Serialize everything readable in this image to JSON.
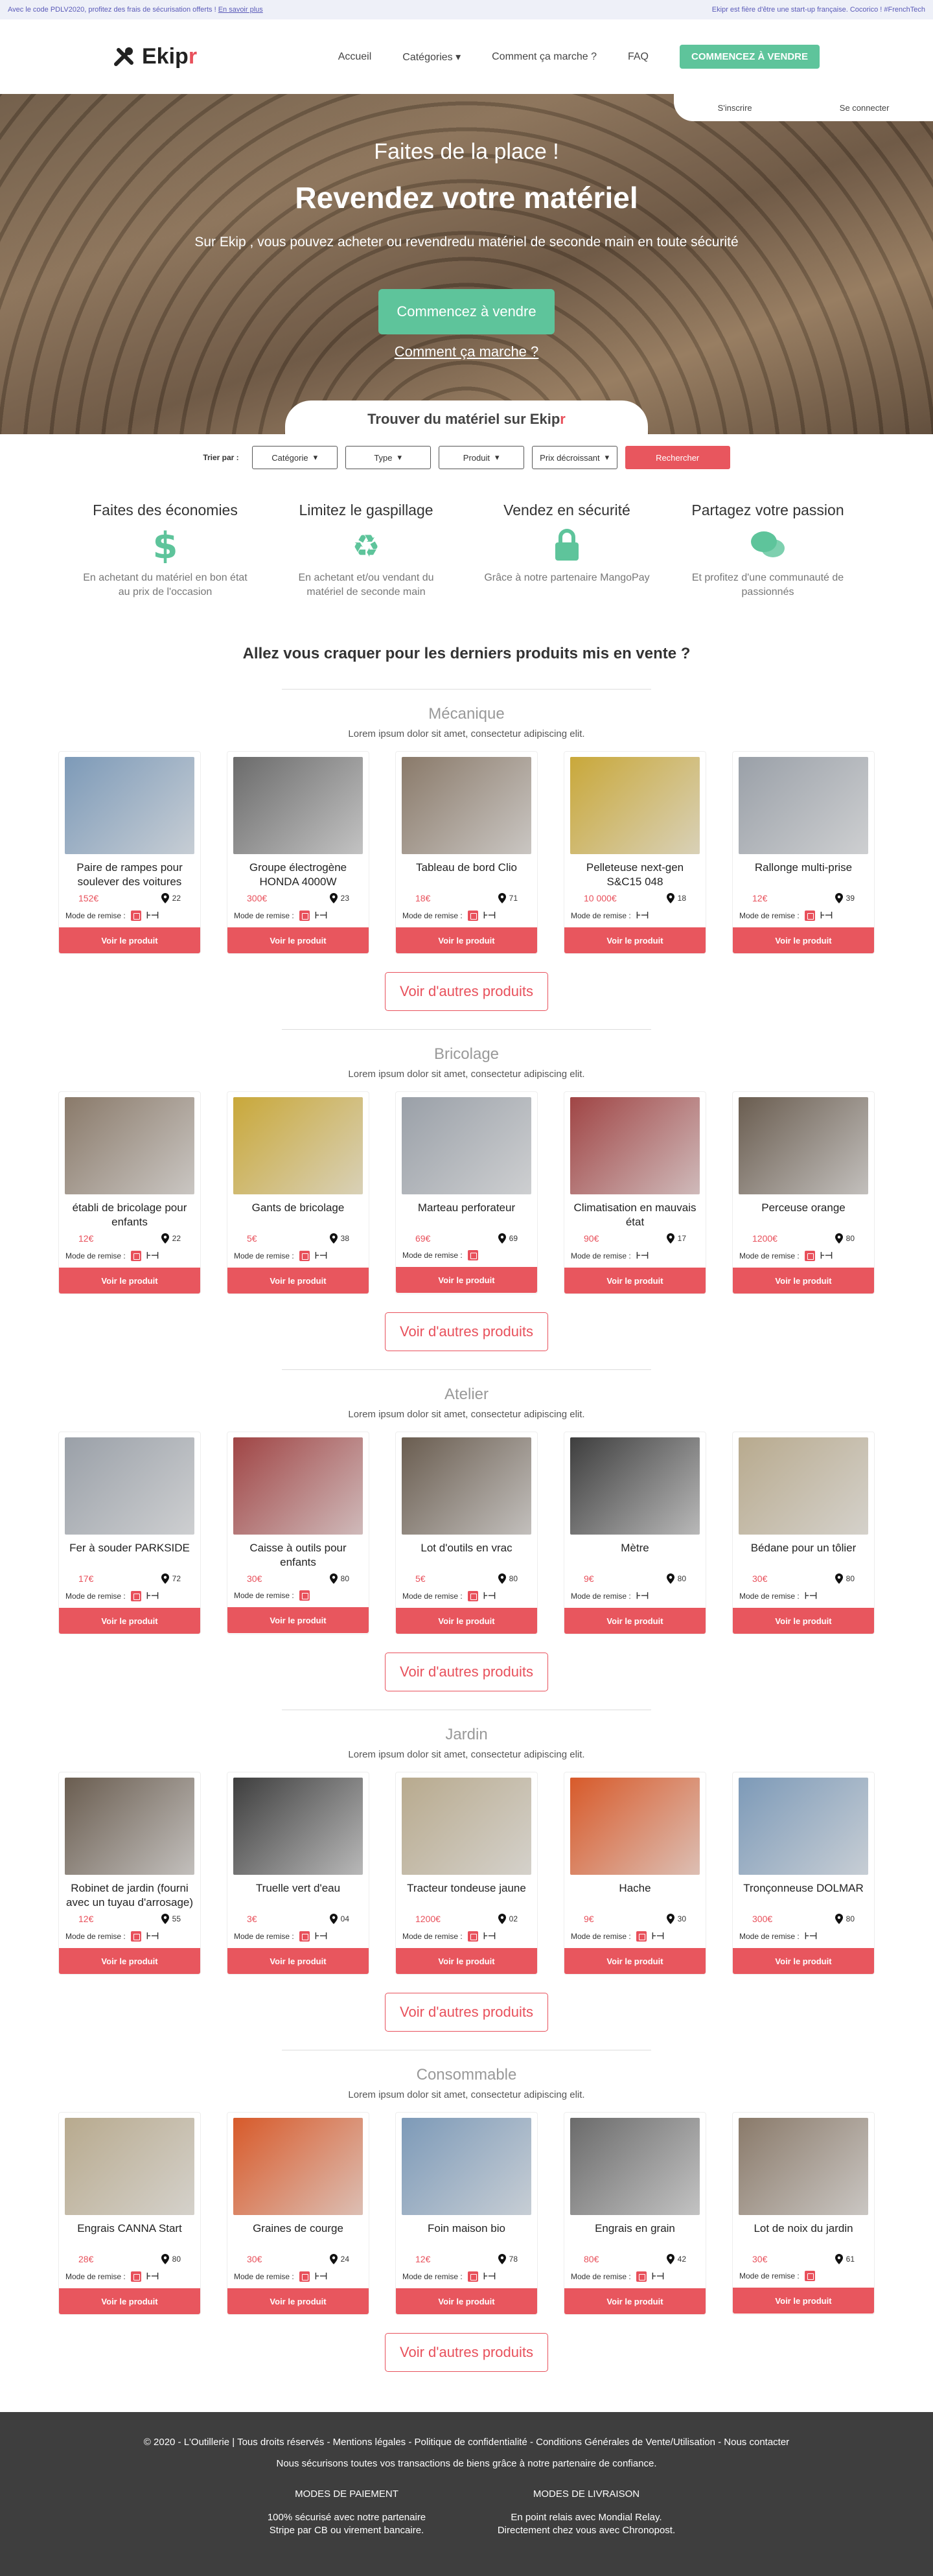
{
  "topbar": {
    "promo": "Avec le code PDLV2020, profitez des frais de sécurisation offerts !",
    "promo_link": "En savoir plus",
    "right": "Ekipr est fière d'être une start-up française. Cocorico ! #FrenchTech"
  },
  "header": {
    "logo_main": "Ekip",
    "logo_accent": "r",
    "nav": [
      "Accueil",
      "Catégories",
      "Comment ça marche ?",
      "FAQ"
    ],
    "cta": "COMMENCEZ À VENDRE"
  },
  "auth": {
    "signup": "S'inscrire",
    "login": "Se connecter"
  },
  "hero": {
    "subtitle": "Faites de la place !",
    "title": "Revendez votre matériel",
    "text": "Sur Ekip , vous pouvez acheter ou revendredu matériel de seconde main en toute sécurité",
    "button": "Commencez à vendre",
    "link": "Comment ça marche ?"
  },
  "search": {
    "title_main": "Trouver du matériel sur Ekip",
    "title_accent": "r",
    "sort_label": "Trier par :",
    "selects": [
      "Catégorie",
      "Type",
      "Produit",
      "Prix décroissant"
    ],
    "button": "Rechercher"
  },
  "features": [
    {
      "title": "Faites des économies",
      "icon": "dollar-icon",
      "text": "En achetant du matériel en bon état au prix de l'occasion"
    },
    {
      "title": "Limitez le gaspillage",
      "icon": "recycle-icon",
      "text": "En achetant et/ou vendant du matériel de seconde main"
    },
    {
      "title": "Vendez en sécurité",
      "icon": "lock-icon",
      "text": "Grâce à notre partenaire MangoPay"
    },
    {
      "title": "Partagez votre passion",
      "icon": "chat-icon",
      "text": "Et profitez d'une communauté de passionnés"
    }
  ],
  "latest_title": "Allez vous craquer pour les derniers produits mis en vente ?",
  "labels": {
    "remise": "Mode de remise :",
    "view": "Voir le produit",
    "more": "Voir d'autres produits"
  },
  "colors": {
    "accent": "#e8505b",
    "green": "#5ec49b",
    "footer": "#3e3e3e"
  },
  "categories": [
    {
      "title": "Mécanique",
      "desc": "Lorem ipsum dolor sit amet, consectetur adipiscing elit.",
      "products": [
        {
          "name": "Paire de rampes pour soulever des voitures",
          "price": "152€",
          "loc": "22",
          "modes": [
            "lock",
            "relay"
          ]
        },
        {
          "name": "Groupe électrogène HONDA 4000W",
          "price": "300€",
          "loc": "23",
          "modes": [
            "lock",
            "relay"
          ]
        },
        {
          "name": "Tableau de bord Clio",
          "price": "18€",
          "loc": "71",
          "modes": [
            "lock",
            "relay"
          ]
        },
        {
          "name": "Pelleteuse next-gen S&C15 048",
          "price": "10 000€",
          "loc": "18",
          "modes": [
            "relay"
          ]
        },
        {
          "name": "Rallonge multi-prise",
          "price": "12€",
          "loc": "39",
          "modes": [
            "lock",
            "relay"
          ]
        }
      ]
    },
    {
      "title": "Bricolage",
      "desc": "Lorem ipsum dolor sit amet, consectetur adipiscing elit.",
      "products": [
        {
          "name": "établi de bricolage pour enfants",
          "price": "12€",
          "loc": "22",
          "modes": [
            "lock",
            "relay"
          ]
        },
        {
          "name": "Gants de bricolage",
          "price": "5€",
          "loc": "38",
          "modes": [
            "lock",
            "relay"
          ]
        },
        {
          "name": "Marteau perforateur",
          "price": "69€",
          "loc": "69",
          "modes": [
            "lock"
          ]
        },
        {
          "name": "Climatisation en mauvais état",
          "price": "90€",
          "loc": "17",
          "modes": [
            "relay"
          ]
        },
        {
          "name": "Perceuse orange",
          "price": "1200€",
          "loc": "80",
          "modes": [
            "lock",
            "relay"
          ]
        }
      ]
    },
    {
      "title": "Atelier",
      "desc": "Lorem ipsum dolor sit amet, consectetur adipiscing elit.",
      "products": [
        {
          "name": "Fer à souder PARKSIDE",
          "price": "17€",
          "loc": "72",
          "modes": [
            "lock",
            "relay"
          ]
        },
        {
          "name": "Caisse à outils pour enfants",
          "price": "30€",
          "loc": "80",
          "modes": [
            "lock"
          ]
        },
        {
          "name": "Lot d'outils en vrac",
          "price": "5€",
          "loc": "80",
          "modes": [
            "lock",
            "relay"
          ]
        },
        {
          "name": "Mètre",
          "price": "9€",
          "loc": "80",
          "modes": [
            "relay"
          ]
        },
        {
          "name": "Bédane pour un tôlier",
          "price": "30€",
          "loc": "80",
          "modes": [
            "relay"
          ]
        }
      ]
    },
    {
      "title": "Jardin",
      "desc": "Lorem ipsum dolor sit amet, consectetur adipiscing elit.",
      "products": [
        {
          "name": "Robinet de jardin (fourni avec un tuyau d'arrosage)",
          "price": "12€",
          "loc": "55",
          "modes": [
            "lock",
            "relay"
          ]
        },
        {
          "name": "Truelle vert d'eau",
          "price": "3€",
          "loc": "04",
          "modes": [
            "lock",
            "relay"
          ]
        },
        {
          "name": "Tracteur tondeuse jaune",
          "price": "1200€",
          "loc": "02",
          "modes": [
            "lock",
            "relay"
          ]
        },
        {
          "name": "Hache",
          "price": "9€",
          "loc": "30",
          "modes": [
            "lock",
            "relay"
          ]
        },
        {
          "name": "Tronçonneuse DOLMAR",
          "price": "300€",
          "loc": "80",
          "modes": [
            "relay"
          ]
        }
      ]
    },
    {
      "title": "Consommable",
      "desc": "Lorem ipsum dolor sit amet, consectetur adipiscing elit.",
      "products": [
        {
          "name": "Engrais CANNA Start",
          "price": "28€",
          "loc": "80",
          "modes": [
            "lock",
            "relay"
          ]
        },
        {
          "name": "Graines de courge",
          "price": "30€",
          "loc": "24",
          "modes": [
            "lock",
            "relay"
          ]
        },
        {
          "name": "Foin maison bio",
          "price": "12€",
          "loc": "78",
          "modes": [
            "lock",
            "relay"
          ]
        },
        {
          "name": "Engrais en grain",
          "price": "80€",
          "loc": "42",
          "modes": [
            "lock",
            "relay"
          ]
        },
        {
          "name": "Lot de noix du jardin",
          "price": "30€",
          "loc": "61",
          "modes": [
            "lock"
          ]
        }
      ]
    }
  ],
  "footer": {
    "links": "© 2020 - L'Outillerie | Tous droits réservés - Mentions légales - Politique de confidentialité - Conditions Générales de Vente/Utilisation - Nous contacter",
    "trust": "Nous sécurisons toutes vos transactions de biens grâce à notre partenaire de confiance.",
    "pay_title": "MODES DE PAIEMENT",
    "pay_l1": "100% sécurisé avec notre partenaire",
    "pay_l2": "Stripe par CB ou virement bancaire.",
    "ship_title": "MODES DE LIVRAISON",
    "ship_l1": "En point relais avec Mondial Relay.",
    "ship_l2": "Directement chez vous avec Chronopost."
  }
}
